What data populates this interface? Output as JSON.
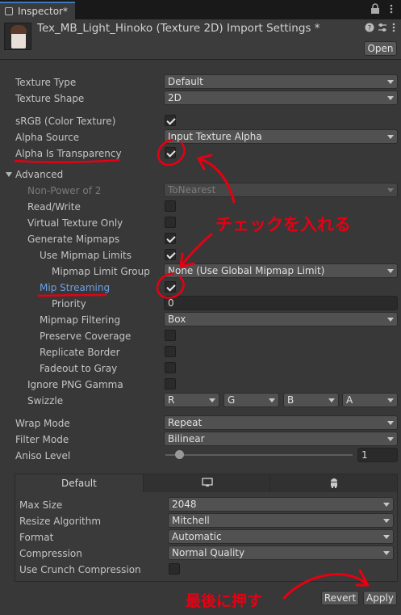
{
  "tab": {
    "title": "Inspector*"
  },
  "header": {
    "title": "Tex_MB_Light_Hinoko (Texture 2D) Import Settings *",
    "open_label": "Open"
  },
  "fields": {
    "texture_type": {
      "label": "Texture Type",
      "value": "Default"
    },
    "texture_shape": {
      "label": "Texture Shape",
      "value": "2D"
    },
    "srgb": {
      "label": "sRGB (Color Texture)",
      "checked": true
    },
    "alpha_source": {
      "label": "Alpha Source",
      "value": "Input Texture Alpha"
    },
    "alpha_transparency": {
      "label": "Alpha Is Transparency",
      "checked": true
    },
    "advanced": {
      "label": "Advanced"
    },
    "npot": {
      "label": "Non-Power of 2",
      "value": "ToNearest"
    },
    "read_write": {
      "label": "Read/Write",
      "checked": false
    },
    "virtual_texture": {
      "label": "Virtual Texture Only",
      "checked": false
    },
    "gen_mipmaps": {
      "label": "Generate Mipmaps",
      "checked": true
    },
    "use_mip_limits": {
      "label": "Use Mipmap Limits",
      "checked": true
    },
    "mip_limit_group": {
      "label": "Mipmap Limit Group",
      "value": "None (Use Global Mipmap Limit)"
    },
    "mip_streaming": {
      "label": "Mip Streaming",
      "checked": true
    },
    "priority": {
      "label": "Priority",
      "value": "0"
    },
    "mip_filtering": {
      "label": "Mipmap Filtering",
      "value": "Box"
    },
    "preserve_coverage": {
      "label": "Preserve Coverage",
      "checked": false
    },
    "replicate_border": {
      "label": "Replicate Border",
      "checked": false
    },
    "fadeout_gray": {
      "label": "Fadeout to Gray",
      "checked": false
    },
    "ignore_png_gamma": {
      "label": "Ignore PNG Gamma",
      "checked": false
    },
    "swizzle": {
      "label": "Swizzle",
      "r": "R",
      "g": "G",
      "b": "B",
      "a": "A"
    },
    "wrap_mode": {
      "label": "Wrap Mode",
      "value": "Repeat"
    },
    "filter_mode": {
      "label": "Filter Mode",
      "value": "Bilinear"
    },
    "aniso_level": {
      "label": "Aniso Level",
      "value": "1"
    }
  },
  "platform": {
    "tabs": {
      "default": "Default",
      "standalone_icon": "monitor-icon",
      "android_icon": "android-icon"
    },
    "max_size": {
      "label": "Max Size",
      "value": "2048"
    },
    "resize_algorithm": {
      "label": "Resize Algorithm",
      "value": "Mitchell"
    },
    "format": {
      "label": "Format",
      "value": "Automatic"
    },
    "compression": {
      "label": "Compression",
      "value": "Normal Quality"
    },
    "crunch": {
      "label": "Use Crunch Compression",
      "checked": false
    }
  },
  "buttons": {
    "revert": "Revert",
    "apply": "Apply"
  },
  "annotations": {
    "check_note": "チェックを入れる",
    "apply_note": "最後に押す",
    "color": "#e60012"
  }
}
